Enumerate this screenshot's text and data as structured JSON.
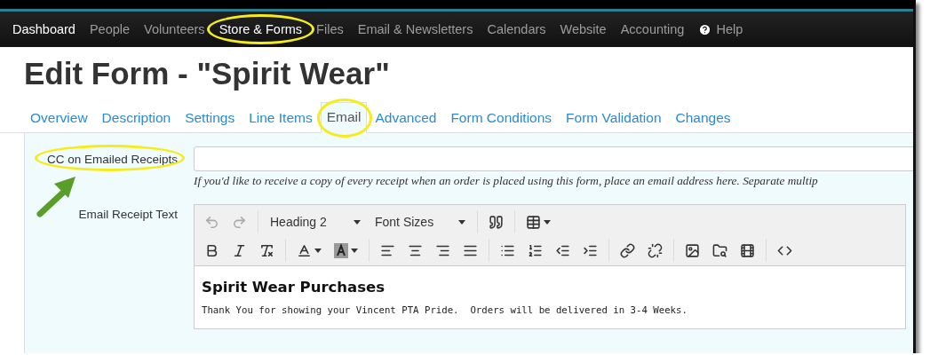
{
  "nav": [
    {
      "label": "Dashboard",
      "kind": "brand",
      "selected": false,
      "highlighted": false
    },
    {
      "label": "People",
      "kind": "link",
      "selected": false,
      "highlighted": false
    },
    {
      "label": "Volunteers",
      "kind": "link",
      "selected": false,
      "highlighted": false
    },
    {
      "label": "Store & Forms",
      "kind": "link",
      "selected": true,
      "highlighted": true
    },
    {
      "label": "Files",
      "kind": "link",
      "selected": false,
      "highlighted": false
    },
    {
      "label": "Email & Newsletters",
      "kind": "link",
      "selected": false,
      "highlighted": false
    },
    {
      "label": "Calendars",
      "kind": "link",
      "selected": false,
      "highlighted": false
    },
    {
      "label": "Website",
      "kind": "link",
      "selected": false,
      "highlighted": false
    },
    {
      "label": "Accounting",
      "kind": "link",
      "selected": false,
      "highlighted": false
    },
    {
      "label": "Help",
      "kind": "help",
      "selected": false,
      "highlighted": false
    }
  ],
  "title": "Edit Form - \"Spirit Wear\"",
  "tabs": [
    {
      "label": "Overview",
      "selected": false,
      "highlighted": false
    },
    {
      "label": "Description",
      "selected": false,
      "highlighted": false
    },
    {
      "label": "Settings",
      "selected": false,
      "highlighted": false
    },
    {
      "label": "Line Items",
      "selected": false,
      "highlighted": false
    },
    {
      "label": "Email",
      "selected": true,
      "highlighted": true
    },
    {
      "label": "Advanced",
      "selected": false,
      "highlighted": false
    },
    {
      "label": "Form Conditions",
      "selected": false,
      "highlighted": false
    },
    {
      "label": "Form Validation",
      "selected": false,
      "highlighted": false
    },
    {
      "label": "Changes",
      "selected": false,
      "highlighted": false
    }
  ],
  "cc_field": {
    "label": "CC on Emailed Receipts",
    "highlighted": true,
    "arrow": true,
    "help": "If you'd like to receive a copy of every receipt when an order is placed using this form, place an email address here. Separate multip"
  },
  "receipt_field": {
    "label": "Email Receipt Text",
    "toolbar": {
      "block_format": "Heading 2",
      "font_size": "Font Sizes"
    },
    "heading": "Spirit Wear Purchases",
    "body": "Thank You for showing your Vincent PTA Pride.  Orders will be delivered in 3-4 Weeks."
  }
}
